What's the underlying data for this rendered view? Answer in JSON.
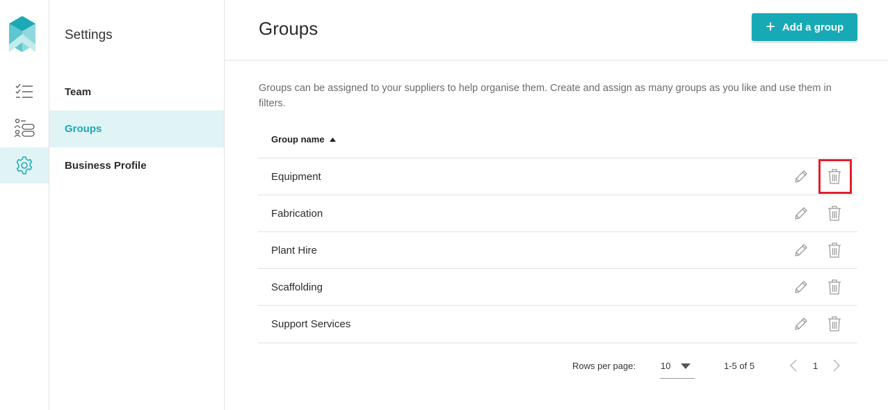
{
  "rail": {
    "items": [
      {
        "icon": "checklist-icon"
      },
      {
        "icon": "suppliers-icon"
      },
      {
        "icon": "gear-icon",
        "active": true
      }
    ]
  },
  "subnav": {
    "title": "Settings",
    "items": [
      {
        "label": "Team"
      },
      {
        "label": "Groups",
        "active": true
      },
      {
        "label": "Business Profile"
      }
    ]
  },
  "header": {
    "title": "Groups",
    "add_button_label": "Add a group"
  },
  "description": "Groups can be assigned to your suppliers to help organise them. Create and assign as many groups as you like and use them in filters.",
  "table": {
    "column_header": "Group name",
    "sort": "ascending",
    "rows": [
      {
        "name": "Equipment",
        "delete_highlighted": true
      },
      {
        "name": "Fabrication"
      },
      {
        "name": "Plant Hire"
      },
      {
        "name": "Scaffolding"
      },
      {
        "name": "Support Services"
      }
    ]
  },
  "pagination": {
    "rows_per_page_label": "Rows per page:",
    "rows_per_page_value": "10",
    "range_text": "1-5 of 5",
    "current_page": "1"
  },
  "colors": {
    "accent": "#17aab6",
    "active_bg": "#e0f3f5",
    "highlight_border": "#e01e2b",
    "icon_gray": "#9a9a9a"
  }
}
